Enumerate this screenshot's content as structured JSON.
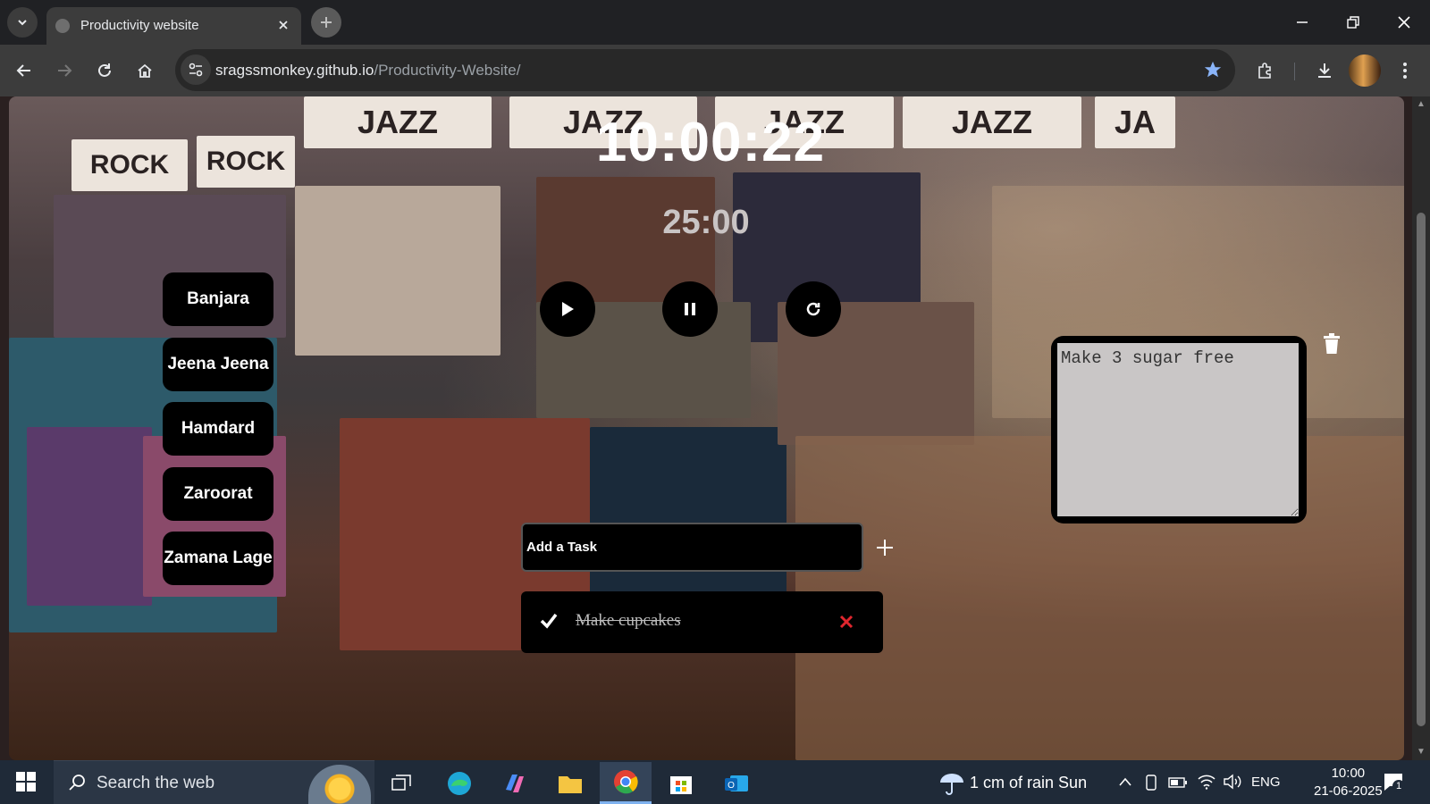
{
  "browser": {
    "tab": {
      "title": "Productivity website"
    },
    "url": {
      "domain": "sragssmonkey.github.io",
      "path": "/Productivity-Website/"
    }
  },
  "page": {
    "background_signs": [
      "JAZZ",
      "JAZZ",
      "JAZZ",
      "JAZZ",
      "JA",
      "ROCK",
      "ROCK"
    ],
    "clock": "10:00:22",
    "timer": "25:00",
    "songs": [
      "Banjara",
      "Jeena Jeena",
      "Hamdard",
      "Zaroorat",
      "Zamana Lage"
    ],
    "task_input_placeholder": "Add a Task",
    "tasks": [
      {
        "text": "Make cupcakes",
        "done": true
      }
    ],
    "notes_value": "Make 3 sugar free"
  },
  "taskbar": {
    "search_placeholder": "Search the web",
    "weather": "1 cm of rain Sun",
    "language": "ENG",
    "time": "10:00",
    "date": "21-06-2025",
    "notification_count": "1"
  },
  "colors": {
    "accent_blue": "#8ab4f8",
    "delete_red": "#e0262e",
    "widget_black": "#000000"
  }
}
